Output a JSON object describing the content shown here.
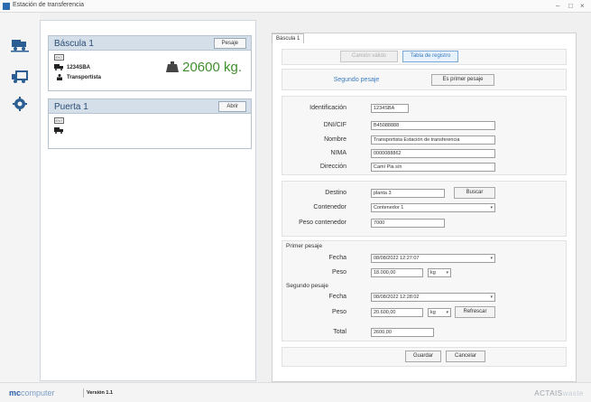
{
  "window": {
    "title": "Estación de transferencia",
    "min_label": "–",
    "max_label": "□",
    "close_label": "×"
  },
  "sidebar": {
    "items": [
      {
        "icon": "scale-truck-icon"
      },
      {
        "icon": "truck-load-icon"
      },
      {
        "icon": "gear-icon"
      }
    ]
  },
  "cards": [
    {
      "title": "Báscula 1",
      "button": "Pesaje",
      "badge": "ENT",
      "plate": "1234SBA",
      "transporter": "Transportista",
      "weight": "20600 kg."
    },
    {
      "title": "Puerta 1",
      "button": "Abrir",
      "badge": "ENT"
    }
  ],
  "tab": {
    "label": "Báscula 1"
  },
  "top_buttons": {
    "disabled_label": "Camión válido",
    "active_label": "Tabla de registro"
  },
  "modes": {
    "second_label": "Segundo pesaje",
    "first_label": "Es primer pesaje"
  },
  "identity": {
    "labels": {
      "id": "Identificación",
      "dni": "DNI/CIF",
      "name": "Nombre",
      "nima": "NIMA",
      "address": "Dirección"
    },
    "values": {
      "id": "1234SBA",
      "dni": "B45088888",
      "name": "Transportista Estación de transferencia",
      "nima": "0000088862",
      "address": "Camí Pla s/n"
    }
  },
  "destination": {
    "labels": {
      "destination": "Destino",
      "container": "Contenedor",
      "container_weight": "Peso contenedor"
    },
    "values": {
      "destination": "planta 3",
      "container": "Contenedor 1",
      "container_weight": "7000"
    },
    "search_button": "Buscar"
  },
  "weighings": {
    "first": {
      "title": "Primer pesaje",
      "date_label": "Fecha",
      "date_value": "08/08/2022 12:27:07",
      "weight_label": "Peso",
      "weight_value": "18.000,00",
      "unit": "kg"
    },
    "second": {
      "title": "Segundo pesaje",
      "date_label": "Fecha",
      "date_value": "08/08/2022 12:28:02",
      "weight_label": "Peso",
      "weight_value": "20.600,00",
      "unit": "kg",
      "refresh_button": "Refrescar"
    },
    "total_label": "Total",
    "total_value": "2600,00"
  },
  "actions": {
    "save": "Guardar",
    "cancel": "Cancelar"
  },
  "footer": {
    "logo_main": "mc",
    "logo_sub": "computer",
    "version": "Versión 1.1",
    "brand": "ACTAIS",
    "brand_accent": "waste"
  },
  "colors": {
    "accent": "#3a7bbf",
    "weight_green": "#3f8f2e",
    "card_header": "#d5dfea"
  }
}
